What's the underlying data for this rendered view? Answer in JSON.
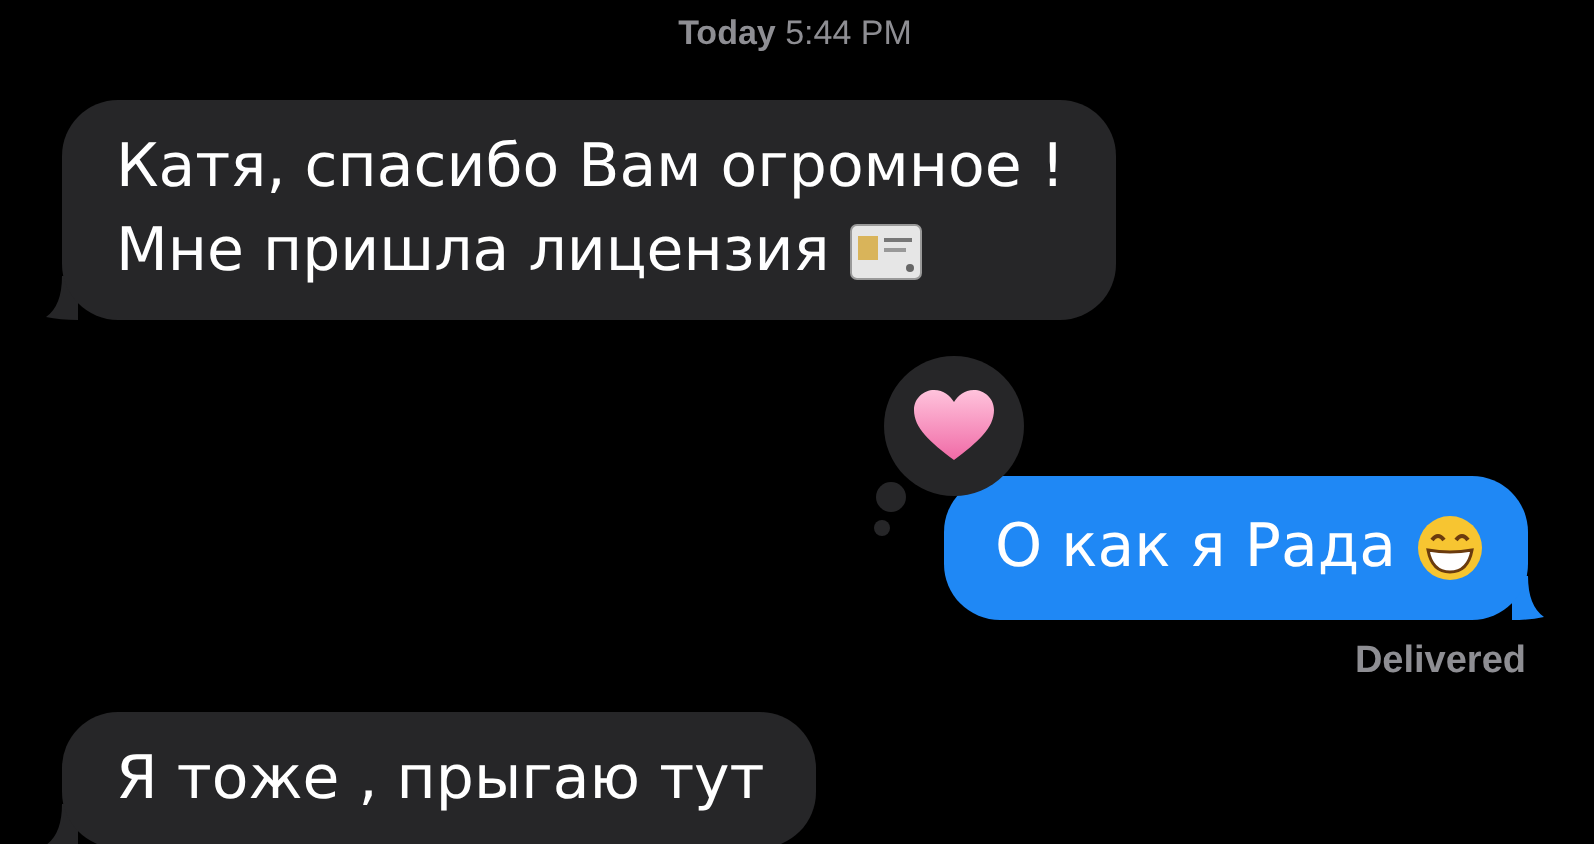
{
  "timestamp": {
    "day": "Today",
    "time": "5:44 PM"
  },
  "messages": [
    {
      "kind": "incoming",
      "lines": [
        "Катя, спасибо Вам огромное !",
        "Мне пришла лицензия"
      ],
      "emoji": {
        "kind": "card"
      }
    },
    {
      "kind": "outgoing",
      "lines": [
        "О как я Рада"
      ],
      "emoji": {
        "kind": "grin"
      },
      "reaction": {
        "kind": "heart"
      },
      "status": "Delivered"
    },
    {
      "kind": "incoming",
      "lines": [
        "Я тоже , прыгаю тут"
      ]
    }
  ]
}
